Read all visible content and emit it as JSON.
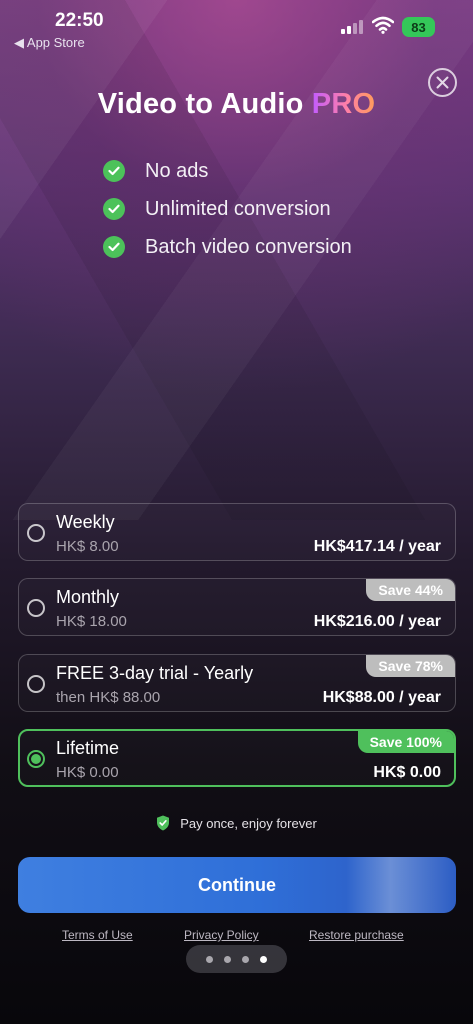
{
  "status_bar": {
    "time": "22:50",
    "back_label": "◀ App Store",
    "battery": "83"
  },
  "title": {
    "main": "Video to Audio ",
    "badge": "PRO"
  },
  "features": [
    {
      "label": "No ads"
    },
    {
      "label": "Unlimited conversion"
    },
    {
      "label": "Batch video conversion"
    }
  ],
  "plans": [
    {
      "name": "Weekly",
      "price": "HK$ 8.00",
      "per_year": "HK$417.14 / year",
      "badge": "",
      "selected": false
    },
    {
      "name": "Monthly",
      "price": "HK$ 18.00",
      "per_year": "HK$216.00 / year",
      "badge": "Save 44%",
      "selected": false
    },
    {
      "name": "FREE 3-day trial - Yearly",
      "price": "then HK$ 88.00",
      "per_year": "HK$88.00 / year",
      "badge": "Save 78%",
      "selected": false
    },
    {
      "name": "Lifetime",
      "price": "HK$ 0.00",
      "per_year": "HK$ 0.00",
      "badge": "Save 100%",
      "selected": true
    }
  ],
  "pay_once": "Pay once, enjoy forever",
  "continue_label": "Continue",
  "links": {
    "terms": "Terms of Use",
    "privacy": "Privacy Policy",
    "restore": "Restore purchase"
  },
  "pager": {
    "count": 4,
    "active_index": 3
  },
  "colors": {
    "accent_green": "#4fc05c",
    "button_blue": "#2f6fd8",
    "badge_gray": "#bdbdbd"
  }
}
